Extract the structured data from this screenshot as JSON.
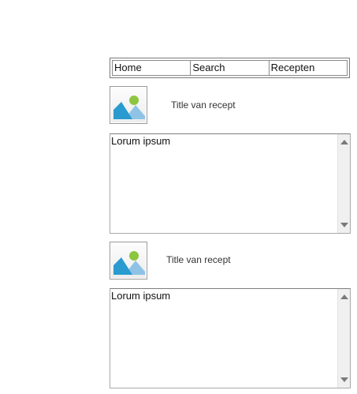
{
  "nav": {
    "items": [
      {
        "label": "Home"
      },
      {
        "label": "Search"
      },
      {
        "label": "Recepten"
      }
    ]
  },
  "recipes": [
    {
      "image_icon": "image-placeholder-icon",
      "title": "Title van recept",
      "body": "Lorum ipsum"
    },
    {
      "image_icon": "image-placeholder-icon",
      "title": "Title van recept",
      "body": "Lorum ipsum"
    }
  ],
  "colors": {
    "image_sky": "#2a9bd0",
    "image_mountain_back": "#8ec3e6",
    "image_sun": "#8cc63f"
  }
}
